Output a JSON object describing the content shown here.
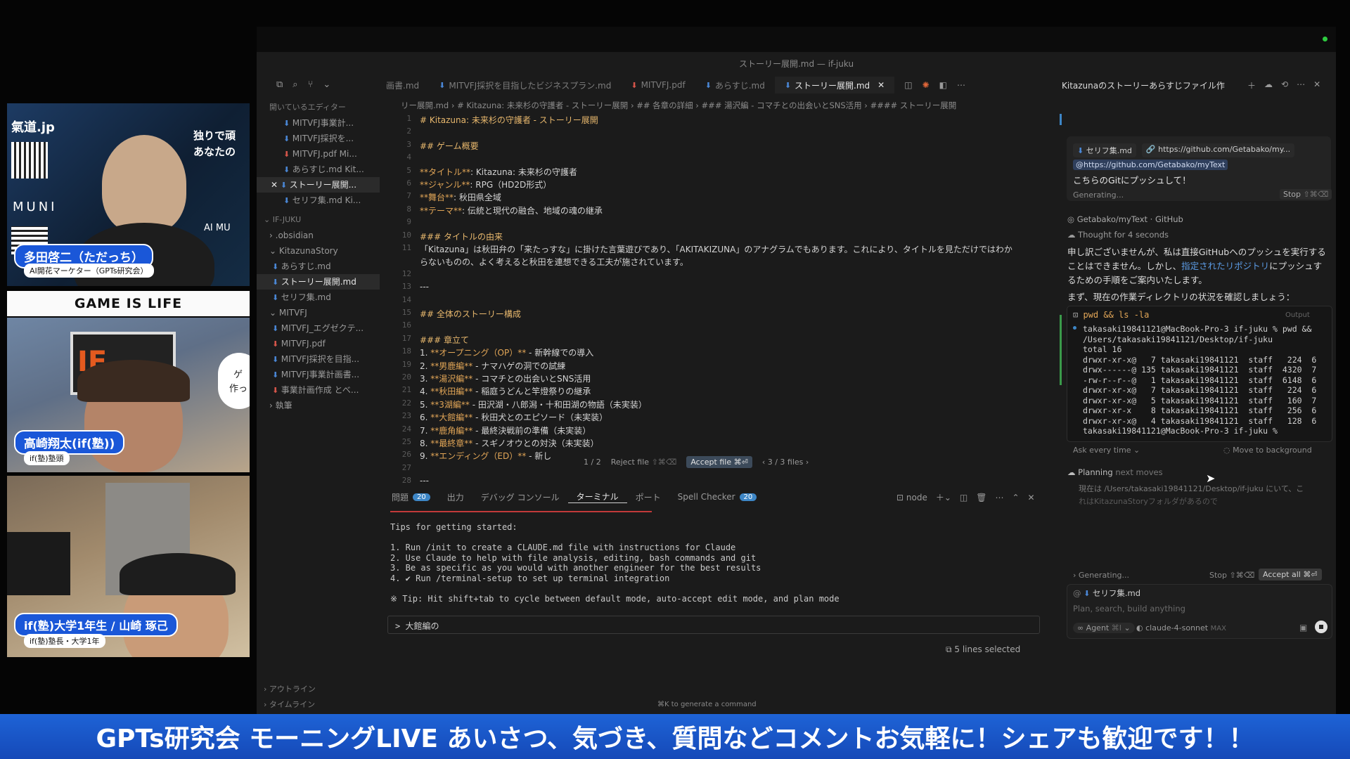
{
  "video": {
    "cam1": {
      "site": "氣道.jp",
      "side_text1": "独りで頑",
      "side_text2": "あなたの",
      "muni": "MUNI",
      "aimu": "AI MU",
      "name": "多田啓二（ただっち）",
      "role": "AI開花マーケター（GPTs研究会）"
    },
    "cam2": {
      "logo": "GAME IS LIFE"
    },
    "cam3": {
      "sign": "IF",
      "bubble1": "ゲ",
      "bubble2": "作っ",
      "name": "高崎翔太(if(塾))",
      "role": "if(塾)塾頭"
    },
    "cam4": {
      "name": "if(塾)大学1年生 / 山崎 琢己",
      "role": "if(塾)塾長・大学1年"
    }
  },
  "window": {
    "title": "ストーリー展開.md — if-juku"
  },
  "tabs": [
    {
      "label": "画書.md",
      "icon": "md"
    },
    {
      "label": "MITVFJ採択を目指したビジネスプラン.md",
      "icon": "md"
    },
    {
      "label": "MITVFJ.pdf",
      "icon": "pdf"
    },
    {
      "label": "あらすじ.md",
      "icon": "md"
    },
    {
      "label": "ストーリー展開.md",
      "icon": "md",
      "active": true
    }
  ],
  "breadcrumb": "リー展開.md › # Kitazuna: 未来杉の守護者 - ストーリー展開 › ## 各章の詳細 › ### 湯沢編 - コマチとの出会いとSNS活用 › #### ストーリー展開",
  "sidebar": {
    "open_editors_label": "開いているエディター",
    "open_editors": [
      "MITVFJ事業計...",
      "MITVFJ採択を...",
      "MITVFJ.pdf Mi...",
      "あらすじ.md Kit...",
      "ストーリー展開...",
      "セリフ集.md Ki..."
    ],
    "root": "IF-JUKU",
    "items": [
      ".obsidian",
      "KitazunaStory",
      "あらすじ.md",
      "ストーリー展開.md",
      "セリフ集.md",
      "MITVFJ",
      "MITVFJ_エグゼクテ...",
      "MITVFJ.pdf",
      "MITVFJ採択を目指...",
      "MITVFJ事業計画書...",
      "事業計画作成 とべ...",
      "執筆"
    ],
    "outline": "アウトライン",
    "timeline": "タイムライン"
  },
  "editor": {
    "lines": [
      {
        "n": "1",
        "t": "# Kitazuna: 未来杉の守護者 - ストーリー展開"
      },
      {
        "n": "2",
        "t": ""
      },
      {
        "n": "3",
        "t": "## ゲーム概要"
      },
      {
        "n": "4",
        "t": ""
      },
      {
        "n": "5",
        "t": "**タイトル**: Kitazuna: 未来杉の守護者"
      },
      {
        "n": "6",
        "t": "**ジャンル**: RPG（HD2D形式）"
      },
      {
        "n": "7",
        "t": "**舞台**: 秋田県全域"
      },
      {
        "n": "8",
        "t": "**テーマ**: 伝統と現代の融合、地域の魂の継承"
      },
      {
        "n": "9",
        "t": ""
      },
      {
        "n": "10",
        "t": "### タイトルの由来"
      },
      {
        "n": "11",
        "t": "「Kitazuna」は秋田弁の「来たっすな」に掛けた言葉遊びであり、「AKITAKIZUNA」のアナグラムでもあります。これにより、タイトルを見ただけではわか"
      },
      {
        "n": "",
        "t": "らないものの、よく考えると秋田を連想できる工夫が施されています。"
      },
      {
        "n": "12",
        "t": ""
      },
      {
        "n": "13",
        "t": "---"
      },
      {
        "n": "14",
        "t": ""
      },
      {
        "n": "15",
        "t": "## 全体のストーリー構成"
      },
      {
        "n": "16",
        "t": ""
      },
      {
        "n": "17",
        "t": "### 章立て"
      },
      {
        "n": "18",
        "t": "1. **オープニング（OP）** - 新幹線での導入"
      },
      {
        "n": "19",
        "t": "2. **男鹿編** - ナマハゲの洞での試練"
      },
      {
        "n": "20",
        "t": "3. **湯沢編** - コマチとの出会いとSNS活用"
      },
      {
        "n": "21",
        "t": "4. **秋田編** - 稲庭うどんと竿燈祭りの継承"
      },
      {
        "n": "22",
        "t": "5. **3湖編** - 田沢湖・八郎潟・十和田湖の物語（未実装）"
      },
      {
        "n": "23",
        "t": "6. **大館編** - 秋田犬とのエピソード（未実装）"
      },
      {
        "n": "24",
        "t": "7. **鹿角編** - 最終決戦前の準備（未実装）"
      },
      {
        "n": "25",
        "t": "8. **最終章** - スギノオウとの対決（未実装）"
      },
      {
        "n": "26",
        "t": "9. **エンディング（ED）** - 新し"
      },
      {
        "n": "27",
        "t": ""
      },
      {
        "n": "28",
        "t": "---"
      }
    ],
    "diff_bar": {
      "nav": "1 / 2",
      "reject": "Reject file",
      "reject_kbd": "⇧⌘⌫",
      "accept": "Accept file",
      "accept_kbd": "⌘⏎",
      "files": "3 / 3 files"
    }
  },
  "panel": {
    "tabs": [
      {
        "label": "問題",
        "count": "20"
      },
      {
        "label": "出力"
      },
      {
        "label": "デバッグ コンソール"
      },
      {
        "label": "ターミナル",
        "active": true
      },
      {
        "label": "ポート"
      },
      {
        "label": "Spell Checker",
        "count": "20"
      }
    ],
    "shell": "node",
    "terminal_lines": [
      "Tips for getting started:",
      "",
      "1. Run /init to create a CLAUDE.md file with instructions for Claude",
      "2. Use Claude to help with file analysis, editing, bash commands and git",
      "3. Be as specific as you would with another engineer for the best results",
      "4. ✔ Run /terminal-setup to set up terminal integration",
      "",
      "※ Tip: Hit shift+tab to cycle between default mode, auto-accept edit mode, and plan mode"
    ],
    "input": "> 大館編の",
    "selection": "5 lines selected",
    "hint": "⌘K to generate a command"
  },
  "chat": {
    "title": "Kitazunaのストーリーあらすじファイル作",
    "context_file": "セリフ集.md",
    "context_url": "https://github.com/Getabako/my...",
    "user_link": "@https://github.com/Getabako/myText",
    "user_msg": "こちらのGitにプッシュして！",
    "generating": "Generating...",
    "stop": "Stop",
    "stop_kbd": "⇧⌘⌫",
    "repo_ref": "Getabako/myText · GitHub",
    "thought": "Thought for 4 seconds",
    "reply1": "申し訳ございませんが、私は直接GitHubへのプッシュを実行することはできません。しかし、",
    "reply1_link": "指定されたリポジトリ",
    "reply1b": "にプッシュするための手順をご案内いたします。",
    "reply2": "まず、現在の作業ディレクトリの状況を確認しましょう：",
    "cmd": "pwd && ls -la",
    "output_label": "Output",
    "term": [
      "takasaki19841121@MacBook-Pro-3 if-juku % pwd &&",
      "/Users/takasaki19841121/Desktop/if-juku",
      "total 16",
      "drwxr-xr-x@   7 takasaki19841121  staff   224  6",
      "drwx------@ 135 takasaki19841121  staff  4320  7",
      "-rw-r--r--@   1 takasaki19841121  staff  6148  6",
      "drwxr-xr-x@   7 takasaki19841121  staff   224  6",
      "drwxr-xr-x@   5 takasaki19841121  staff   160  7",
      "drwxr-xr-x    8 takasaki19841121  staff   256  6",
      "drwxr-xr-x@   4 takasaki19841121  staff   128  6",
      "takasaki19841121@MacBook-Pro-3 if-juku %"
    ],
    "ask": "Ask every time",
    "move_bg": "Move to background",
    "planning": "Planning",
    "planning_sub": "next moves",
    "planning_text1": "現在は /Users/takasaki19841121/Desktop/if-juku にいて、こ",
    "planning_text2": "れはKitazunaStoryフォルダがあるので",
    "gen2": "Generating...",
    "stop2": "Stop",
    "accept_all": "Accept all",
    "accept_kbd": "⌘⏎",
    "bottom_file": "セリフ集.md",
    "input_placeholder": "Plan, search, build anything",
    "agent": "Agent",
    "agent_kbd": "⌘I",
    "model": "claude-4-sonnet",
    "max": "MAX"
  },
  "banner": "GPTs研究会 モーニングLIVE あいさつ、気づき、質問などコメントお気軽に！シェアも歓迎です！！"
}
